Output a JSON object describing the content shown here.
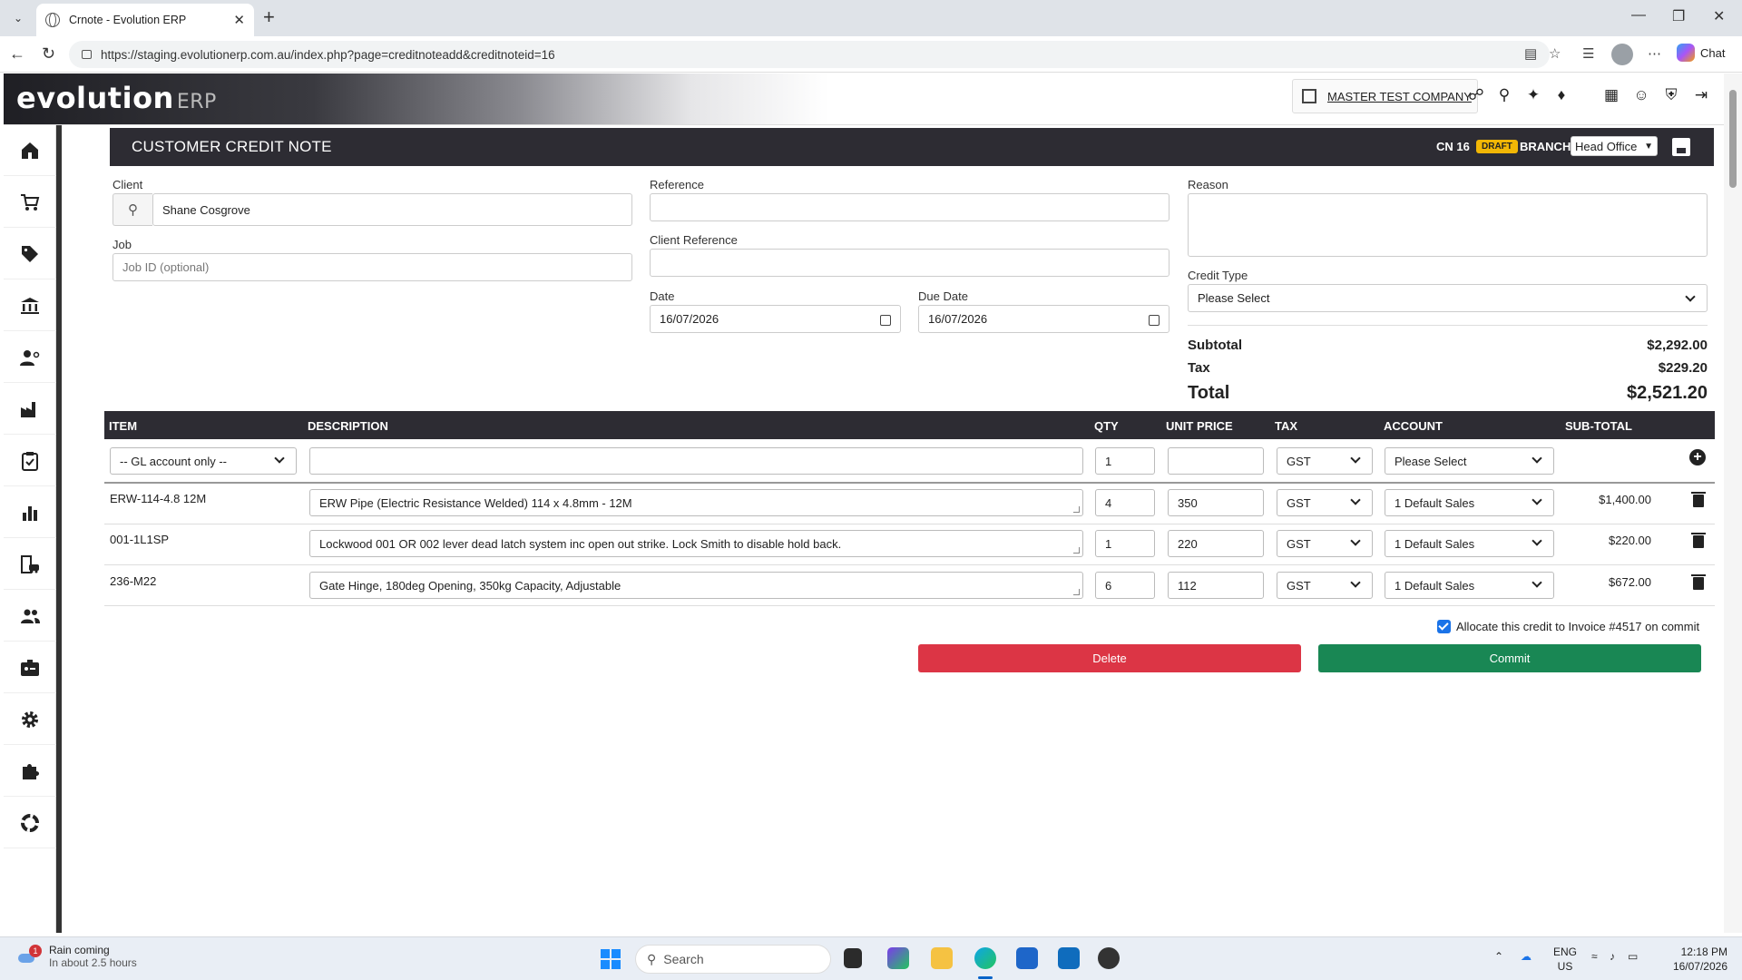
{
  "browser": {
    "tab_title": "Crnote - Evolution ERP",
    "url": "https://staging.evolutionerp.com.au/index.php?page=creditnoteadd&creditnoteid=16",
    "chat_label": "Chat"
  },
  "header": {
    "logo_main": "evolution",
    "logo_suffix": "ERP",
    "company": "MASTER TEST COMPANY"
  },
  "page": {
    "title": "CUSTOMER CREDIT NOTE",
    "cn_number": "CN 16",
    "status_badge": "DRAFT",
    "branch_label": "BRANCH",
    "branch_value": "Head Office"
  },
  "form": {
    "client_label": "Client",
    "client_value": "Shane Cosgrove",
    "job_label": "Job",
    "job_placeholder": "Job ID (optional)",
    "reference_label": "Reference",
    "reference_value": "",
    "client_reference_label": "Client Reference",
    "client_reference_value": "",
    "date_label": "Date",
    "date_value": "16/07/2026",
    "due_date_label": "Due Date",
    "due_date_value": "16/07/2026",
    "reason_label": "Reason",
    "reason_value": "",
    "credit_type_label": "Credit Type",
    "credit_type_value": "Please Select"
  },
  "totals": {
    "subtotal_label": "Subtotal",
    "subtotal_value": "$2,292.00",
    "tax_label": "Tax",
    "tax_value": "$229.20",
    "total_label": "Total",
    "total_value": "$2,521.20"
  },
  "table": {
    "headers": [
      "ITEM",
      "DESCRIPTION",
      "QTY",
      "UNIT PRICE",
      "TAX",
      "ACCOUNT",
      "SUB-TOTAL"
    ],
    "new_row": {
      "item_select": "-- GL account only --",
      "description": "",
      "qty": "1",
      "unit_price": "",
      "tax": "GST",
      "account": "Please Select"
    },
    "rows": [
      {
        "item": "ERW-114-4.8 12M",
        "description": "ERW Pipe (Electric Resistance Welded) 114 x 4.8mm - 12M",
        "qty": "4",
        "unit_price": "350",
        "tax": "GST",
        "account": "1 Default Sales",
        "subtotal": "$1,400.00"
      },
      {
        "item": "001-1L1SP",
        "description": "Lockwood 001 OR 002 lever dead latch system inc open out strike. Lock Smith to disable hold back.",
        "qty": "1",
        "unit_price": "220",
        "tax": "GST",
        "account": "1 Default Sales",
        "subtotal": "$220.00"
      },
      {
        "item": "236-M22",
        "description": "Gate Hinge, 180deg Opening, 350kg Capacity, Adjustable",
        "qty": "6",
        "unit_price": "112",
        "tax": "GST",
        "account": "1 Default Sales",
        "subtotal": "$672.00"
      }
    ]
  },
  "actions": {
    "allocate_label": "Allocate this credit to Invoice #4517 on commit",
    "allocate_checked": true,
    "delete_label": "Delete",
    "commit_label": "Commit"
  },
  "taskbar": {
    "weather_title": "Rain coming",
    "weather_sub": "In about 2.5 hours",
    "weather_badge": "1",
    "search_placeholder": "Search",
    "lang_1": "ENG",
    "lang_2": "US",
    "time": "12:18 PM",
    "date": "16/07/2026"
  },
  "colors": {
    "title_bar": "#2d2c33",
    "draft_badge": "#f2b705",
    "delete_button": "#dc3545",
    "commit_button": "#198754"
  }
}
